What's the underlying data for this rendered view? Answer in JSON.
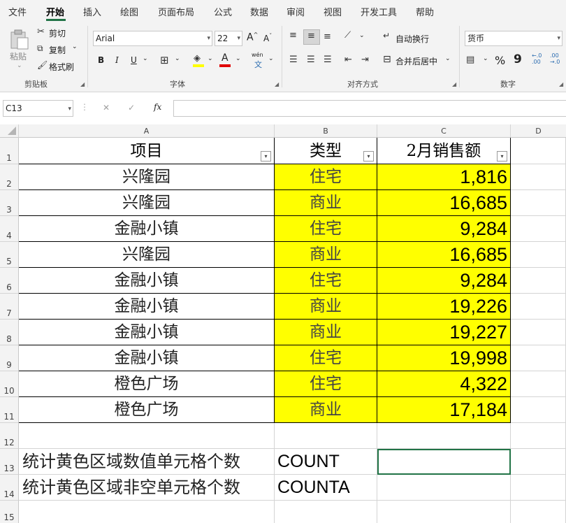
{
  "tabs": [
    "文件",
    "开始",
    "插入",
    "绘图",
    "页面布局",
    "公式",
    "数据",
    "审阅",
    "视图",
    "开发工具",
    "帮助"
  ],
  "active_tab": "开始",
  "ribbon": {
    "clipboard": {
      "paste": "粘贴",
      "cut": "剪切",
      "copy": "复制",
      "format_painter": "格式刷",
      "label": "剪贴板"
    },
    "font": {
      "name": "Arial",
      "size": "22",
      "grow": "A",
      "shrink": "A",
      "bold": "B",
      "italic": "I",
      "underline": "U",
      "wen": "wén",
      "wen2": "文",
      "label": "字体"
    },
    "align": {
      "wrap": "自动换行",
      "merge": "合并后居中",
      "label": "对齐方式"
    },
    "number": {
      "format": "货币",
      "percent": "%",
      "comma": "9",
      "inc": "←.0 .00",
      "dec": ".00 →.0",
      "label": "数字"
    }
  },
  "formula_bar": {
    "name_box": "C13",
    "cancel": "✕",
    "enter": "✓",
    "fx": "fx",
    "formula": ""
  },
  "columns": [
    "A",
    "B",
    "C",
    "D"
  ],
  "rows": [
    "1",
    "2",
    "3",
    "4",
    "5",
    "6",
    "7",
    "8",
    "9",
    "10",
    "11",
    "12",
    "13",
    "14",
    "15"
  ],
  "header": {
    "a": "项目",
    "b": "类型",
    "c": "2月销售额"
  },
  "data": [
    {
      "project": "兴隆园",
      "type": "住宅",
      "sales": "1,816"
    },
    {
      "project": "兴隆园",
      "type": "商业",
      "sales": "16,685"
    },
    {
      "project": "金融小镇",
      "type": "住宅",
      "sales": "9,284"
    },
    {
      "project": "兴隆园",
      "type": "商业",
      "sales": "16,685"
    },
    {
      "project": "金融小镇",
      "type": "住宅",
      "sales": "9,284"
    },
    {
      "project": "金融小镇",
      "type": "商业",
      "sales": "19,226"
    },
    {
      "project": "金融小镇",
      "type": "商业",
      "sales": "19,227"
    },
    {
      "project": "金融小镇",
      "type": "住宅",
      "sales": "19,998"
    },
    {
      "project": "橙色广场",
      "type": "住宅",
      "sales": "4,322"
    },
    {
      "project": "橙色广场",
      "type": "商业",
      "sales": "17,184"
    }
  ],
  "notes": [
    {
      "label": "统计黄色区域数值单元格个数",
      "func": "COUNT"
    },
    {
      "label": "统计黄色区域非空单元格个数",
      "func": "COUNTA"
    }
  ],
  "colors": {
    "accent": "#217346",
    "highlight": "#ffff00"
  }
}
